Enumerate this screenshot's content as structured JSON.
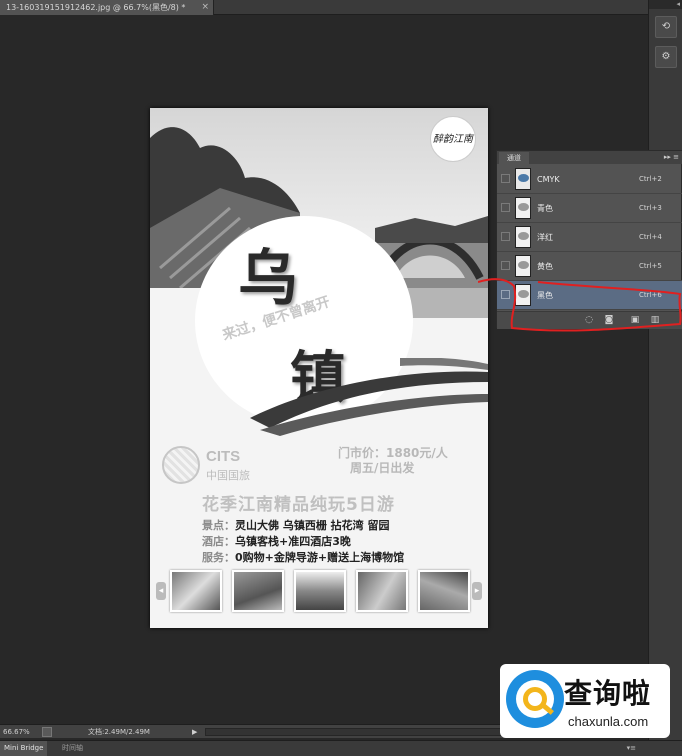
{
  "document_tab": {
    "title": "13-160319151912462.jpg @ 66.7%(黑色/8) *",
    "close": "×"
  },
  "dock": {
    "collapse": "◂",
    "btn1": "⟲",
    "btn2": "⚙"
  },
  "poster": {
    "stamp_text": "醉韵江南",
    "title_char1": "乌",
    "slogan": "来过，便不曾离开",
    "title_char2": "镇",
    "logo_en": "CITS",
    "logo_cn": "中国国旅",
    "price_line1": "门市价：1880元/人",
    "price_line2": "周五/日出发",
    "headline": "花季江南精品纯玩5日游",
    "info": [
      {
        "k": "景点：",
        "v": "灵山大佛  乌镇西栅  拈花湾  留园"
      },
      {
        "k": "酒店：",
        "v": "乌镇客栈+准四酒店3晚"
      },
      {
        "k": "服务：",
        "v": "0购物+金牌导游+赠送上海博物馆"
      }
    ],
    "arrow_left": "◂",
    "arrow_right": "▸"
  },
  "channels_panel": {
    "tab": "通道",
    "controls": "▸▸ ≡",
    "channels": [
      {
        "name": "CMYK",
        "shortcut": "Ctrl+2",
        "selected": false
      },
      {
        "name": "青色",
        "shortcut": "Ctrl+3",
        "selected": false
      },
      {
        "name": "洋红",
        "shortcut": "Ctrl+4",
        "selected": false
      },
      {
        "name": "黄色",
        "shortcut": "Ctrl+5",
        "selected": false
      },
      {
        "name": "黑色",
        "shortcut": "Ctrl+6",
        "selected": true
      }
    ],
    "footer_icons": [
      "dotted-circle-icon",
      "mask-icon",
      "new-channel-icon",
      "trash-icon"
    ]
  },
  "status": {
    "zoom": "66.67%",
    "doc_size": "文档:2.49M/2.49M",
    "arrow": "▶"
  },
  "bottom_tabs": [
    {
      "label": "Mini Bridge",
      "active": true
    },
    {
      "label": "时间轴",
      "active": false
    }
  ],
  "bottom_menu": "▾≡",
  "watermark": {
    "cn": "查询啦",
    "en": "chaxunla.com"
  },
  "colors": {
    "app_bg": "#282828",
    "panel_bg": "#535353",
    "selected_row": "#5b6c84",
    "annotation": "#e02020",
    "watermark_blue": "#1e8ede",
    "watermark_yellow": "#f3b51b"
  }
}
